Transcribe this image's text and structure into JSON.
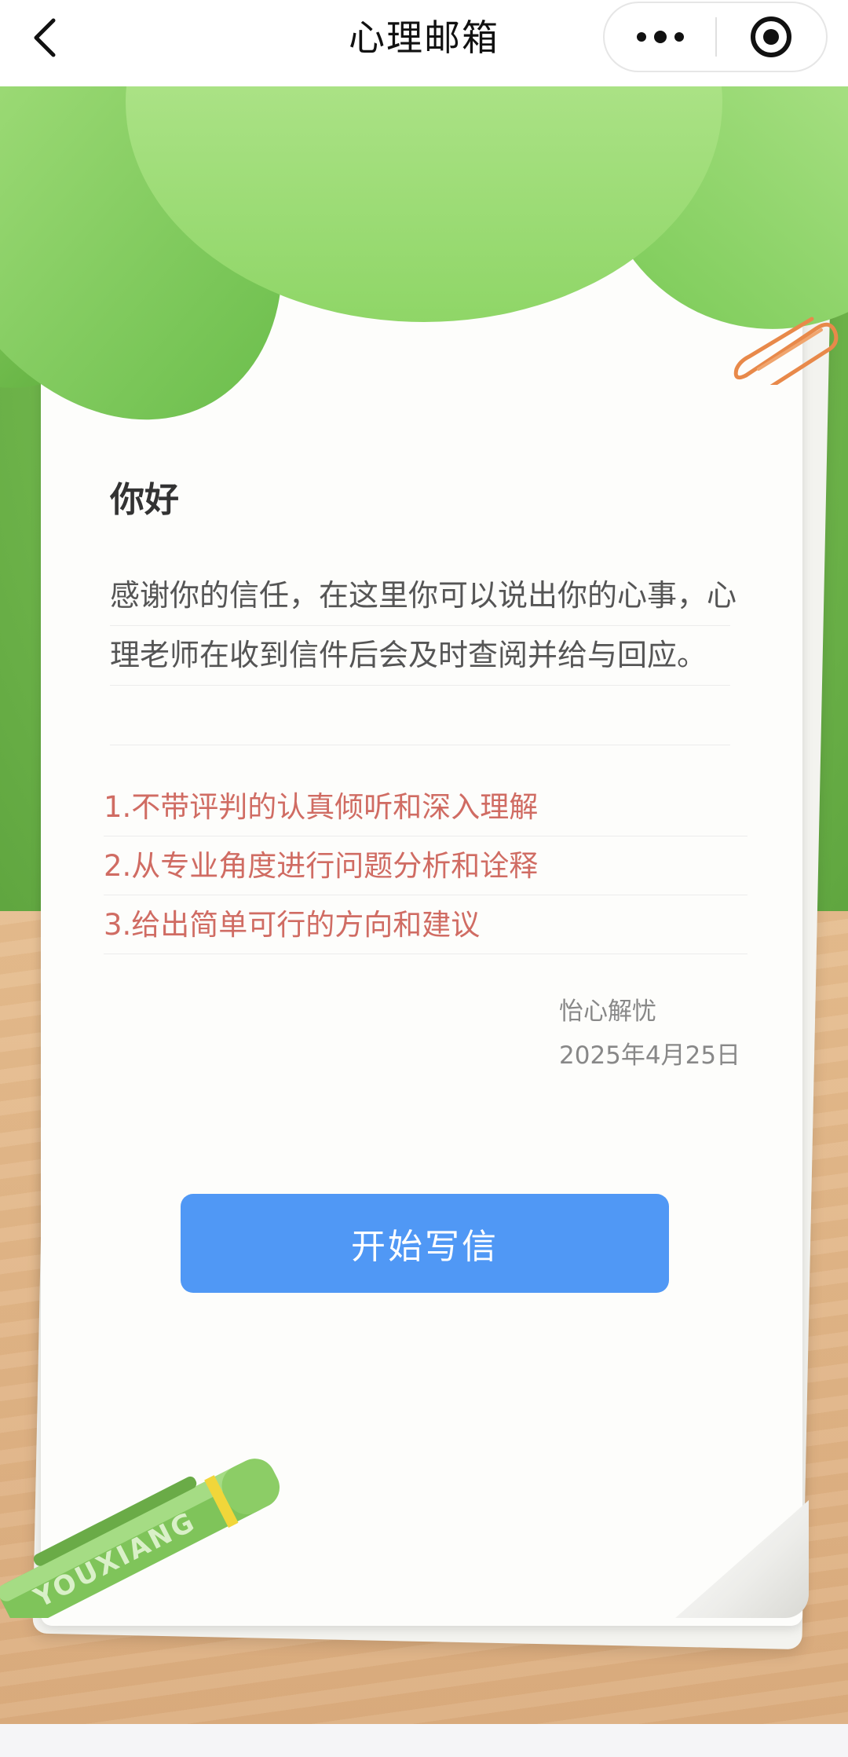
{
  "navbar": {
    "title": "心理邮箱"
  },
  "letter": {
    "greeting": "你好",
    "intro": "感谢你的信任，在这里你可以说出你的心事，心理老师在收到信件后会及时查阅并给与回应。",
    "points": [
      "1.不带评判的认真倾听和深入理解",
      "2.从专业角度进行问题分析和诠释",
      "3.给出简单可行的方向和建议"
    ],
    "signature_name": "怡心解忧",
    "signature_date": "2025年4月25日"
  },
  "actions": {
    "start_writing": "开始写信"
  },
  "decor": {
    "pen_text": "YOUXIANG"
  },
  "colors": {
    "accent_button": "#5098f5",
    "points_text": "#d06c63",
    "leaf_green": "#8fd667",
    "wood": "#ddb083"
  },
  "icons": {
    "back": "chevron-left-icon",
    "more": "more-dots-icon",
    "close": "target-circle-icon",
    "paperclip": "paperclip-icon"
  }
}
